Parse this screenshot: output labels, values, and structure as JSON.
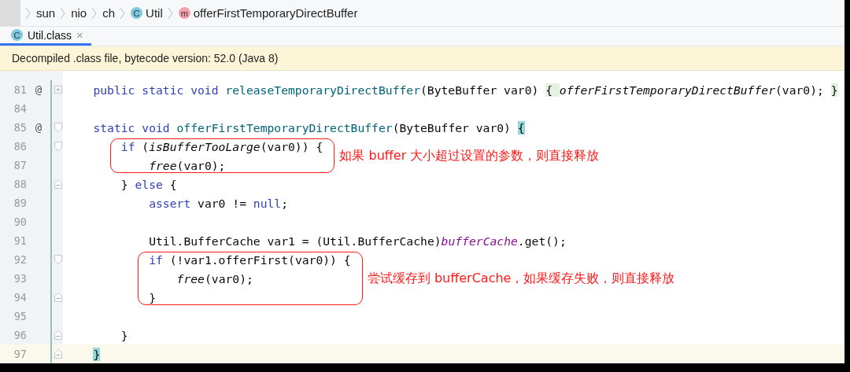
{
  "breadcrumb": [
    {
      "label": "sun"
    },
    {
      "label": "nio"
    },
    {
      "label": "ch"
    },
    {
      "label": "Util",
      "badge": "C",
      "kind": "class"
    },
    {
      "label": "offerFirstTemporaryDirectBuffer",
      "badge": "m",
      "kind": "method"
    }
  ],
  "tabs": [
    {
      "label": "Util.class",
      "badge": "C",
      "close": "×",
      "selected": true
    }
  ],
  "banner": "Decompiled .class file, bytecode version: 52.0 (Java 8)",
  "code": {
    "lines": [
      {
        "number": "81",
        "marker": "@",
        "kind": "collapsed",
        "boxed": false,
        "segments": [
          {
            "text": "public static void ",
            "kind": "keyword"
          },
          {
            "text": "releaseTemporaryDirectBuffer",
            "kind": "declaration"
          },
          {
            "text": "(ByteBuffer var0) ",
            "kind": "plain"
          },
          {
            "text": "{ ",
            "kind": "folded"
          },
          {
            "text": "offerFirstTemporaryDirectBuffer",
            "kind": "static-call"
          },
          {
            "text": "(var0); ",
            "kind": "plain"
          },
          {
            "text": "}",
            "kind": "folded"
          }
        ]
      },
      {
        "number": "84",
        "boxed": false
      },
      {
        "number": "85",
        "marker": "@",
        "kind": "fold-start",
        "boxed": false,
        "segments": [
          {
            "text": "static void ",
            "kind": "keyword"
          },
          {
            "text": "offerFirstTemporaryDirectBuffer",
            "kind": "declaration"
          },
          {
            "text": "(ByteBuffer var0) ",
            "kind": "plain"
          },
          {
            "text": "{",
            "kind": "match"
          }
        ],
        "children": [
          {
            "number": "86",
            "kind": "fold-start",
            "boxed": true,
            "note": "如果 buffer 大小超过设置的参数，则直接释放",
            "segments": [
              {
                "text": "if ",
                "kind": "keyword"
              },
              {
                "text": "(",
                "kind": "plain"
              },
              {
                "text": "isBufferTooLarge",
                "kind": "static-call"
              },
              {
                "text": "(var0)) {",
                "kind": "plain"
              }
            ],
            "children": [
              {
                "number": "87",
                "boxed": true,
                "segments": [
                  {
                    "text": "free",
                    "kind": "static-call"
                  },
                  {
                    "text": "(var0);",
                    "kind": "plain"
                  }
                ]
              }
            ]
          },
          {
            "number": "88",
            "kind": "fold-end",
            "boxed": false,
            "segments": [
              {
                "text": "} ",
                "kind": "plain"
              },
              {
                "text": "else",
                "kind": "keyword"
              },
              {
                "text": " {",
                "kind": "plain"
              }
            ],
            "children": [
              {
                "number": "89",
                "boxed": false,
                "segments": [
                  {
                    "text": "assert",
                    "kind": "keyword"
                  },
                  {
                    "text": " var0 != ",
                    "kind": "plain"
                  },
                  {
                    "text": "null",
                    "kind": "keyword"
                  },
                  {
                    "text": ";",
                    "kind": "plain"
                  }
                ]
              },
              {
                "number": "90",
                "boxed": false
              },
              {
                "number": "91",
                "boxed": false,
                "segments": [
                  {
                    "text": "Util.BufferCache var1 = (Util.BufferCache)",
                    "kind": "plain"
                  },
                  {
                    "text": "bufferCache",
                    "kind": "static-field"
                  },
                  {
                    "text": ".get();",
                    "kind": "plain"
                  }
                ]
              },
              {
                "number": "92",
                "kind": "fold-start",
                "boxed": true,
                "note": "尝试缓存到 bufferCache，如果缓存失败，则直接释放",
                "segments": [
                  {
                    "text": "if ",
                    "kind": "keyword"
                  },
                  {
                    "text": "(!var1.offerFirst(var0)) {",
                    "kind": "plain"
                  }
                ],
                "children": [
                  {
                    "number": "93",
                    "boxed": true,
                    "segments": [
                      {
                        "text": "free",
                        "kind": "static-call"
                      },
                      {
                        "text": "(var0);",
                        "kind": "plain"
                      }
                    ]
                  }
                ]
              },
              {
                "number": "94",
                "kind": "fold-end",
                "boxed": true,
                "segments": [
                  {
                    "text": "}",
                    "kind": "plain"
                  }
                ]
              },
              {
                "number": "95",
                "boxed": false
              }
            ]
          },
          {
            "number": "96",
            "kind": "fold-end",
            "boxed": false,
            "segments": [
              {
                "text": "}",
                "kind": "plain"
              }
            ]
          }
        ]
      },
      {
        "number": "97",
        "kind": "fold-end",
        "boxed": false,
        "current": true,
        "segments": [
          {
            "text": "}",
            "kind": "match"
          }
        ]
      }
    ]
  }
}
